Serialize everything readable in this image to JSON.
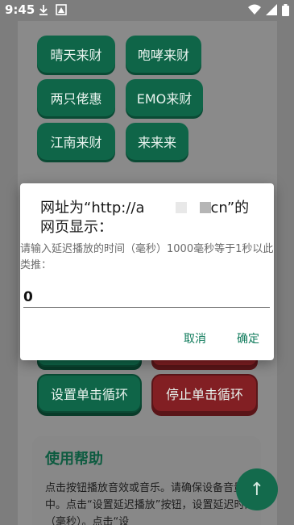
{
  "status_bar": {
    "time": "9:45",
    "left_icons": [
      "download-icon",
      "image-icon"
    ],
    "right_icons": [
      "wifi-icon",
      "signal-icon",
      "battery-icon"
    ]
  },
  "sound_buttons": [
    {
      "label": "晴天来财"
    },
    {
      "label": "咆哮来财"
    },
    {
      "label": "两只佬惠"
    },
    {
      "label": "EMO来财"
    },
    {
      "label": "江南来财"
    },
    {
      "label": "来来来"
    }
  ],
  "loop_buttons": {
    "set_loop": "设置单击循环",
    "stop_loop": "停止单击循环"
  },
  "help": {
    "title": "使用帮助",
    "text": "点击按钮播放音效或音乐。请确保设备音量适中。点击“设置延迟播放”按钮，设置延迟时间（毫秒）。点击“设"
  },
  "fab": {
    "icon": "arrow-up-icon",
    "label": "↑"
  },
  "dialog": {
    "title_prefix": "网址为“http://a",
    "title_suffix": "cn”的网页显示：",
    "message": "请输入延迟播放的时间（毫秒）1000毫秒等于1秒以此类推：",
    "input_value": "0",
    "cancel_label": "取消",
    "ok_label": "确定"
  },
  "colors": {
    "accent": "#0d7a5a",
    "scrim": "#7d7d7d",
    "green_button": "#0f6548",
    "red_button": "#821f23"
  }
}
